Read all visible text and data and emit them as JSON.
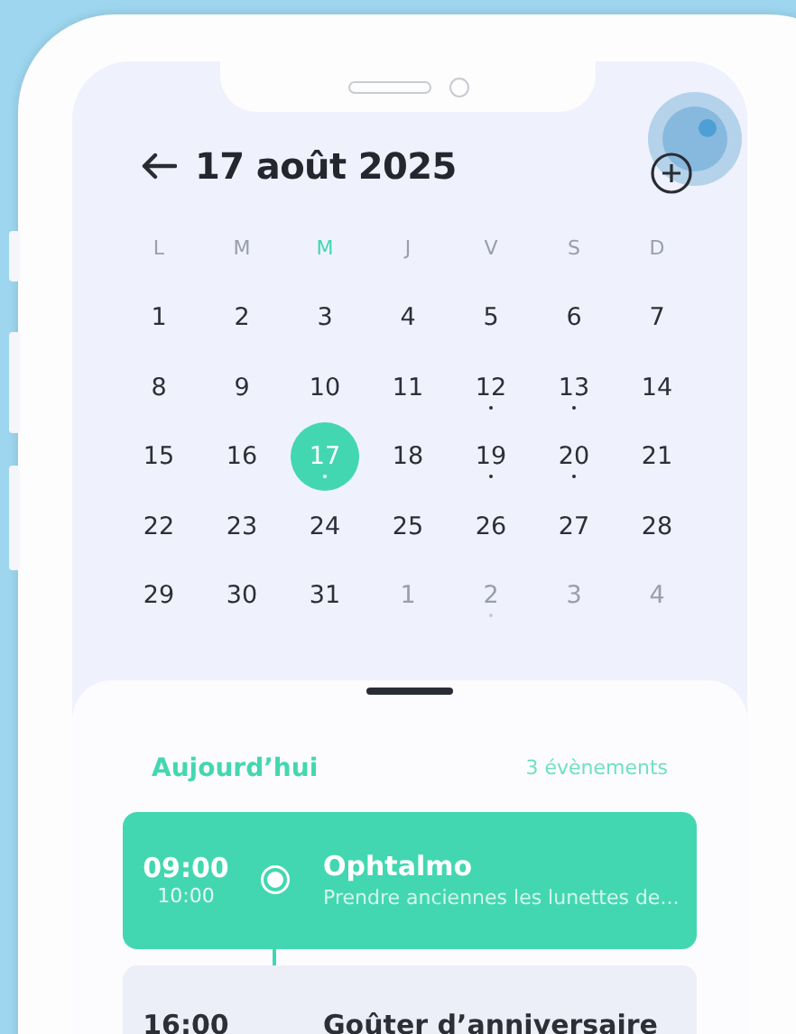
{
  "header": {
    "title": "17 août 2025"
  },
  "weekdays": [
    {
      "label": "L",
      "selected": false
    },
    {
      "label": "M",
      "selected": false
    },
    {
      "label": "M",
      "selected": true
    },
    {
      "label": "J",
      "selected": false
    },
    {
      "label": "V",
      "selected": false
    },
    {
      "label": "S",
      "selected": false
    },
    {
      "label": "D",
      "selected": false
    }
  ],
  "days": [
    {
      "label": "1",
      "muted": false,
      "selected": false,
      "has_event": false
    },
    {
      "label": "2",
      "muted": false,
      "selected": false,
      "has_event": false
    },
    {
      "label": "3",
      "muted": false,
      "selected": false,
      "has_event": false
    },
    {
      "label": "4",
      "muted": false,
      "selected": false,
      "has_event": false
    },
    {
      "label": "5",
      "muted": false,
      "selected": false,
      "has_event": false
    },
    {
      "label": "6",
      "muted": false,
      "selected": false,
      "has_event": false
    },
    {
      "label": "7",
      "muted": false,
      "selected": false,
      "has_event": false
    },
    {
      "label": "8",
      "muted": false,
      "selected": false,
      "has_event": false
    },
    {
      "label": "9",
      "muted": false,
      "selected": false,
      "has_event": false
    },
    {
      "label": "10",
      "muted": false,
      "selected": false,
      "has_event": false
    },
    {
      "label": "11",
      "muted": false,
      "selected": false,
      "has_event": false
    },
    {
      "label": "12",
      "muted": false,
      "selected": false,
      "has_event": true
    },
    {
      "label": "13",
      "muted": false,
      "selected": false,
      "has_event": true
    },
    {
      "label": "14",
      "muted": false,
      "selected": false,
      "has_event": false
    },
    {
      "label": "15",
      "muted": false,
      "selected": false,
      "has_event": false
    },
    {
      "label": "16",
      "muted": false,
      "selected": false,
      "has_event": false
    },
    {
      "label": "17",
      "muted": false,
      "selected": true,
      "has_event": true
    },
    {
      "label": "18",
      "muted": false,
      "selected": false,
      "has_event": false
    },
    {
      "label": "19",
      "muted": false,
      "selected": false,
      "has_event": true
    },
    {
      "label": "20",
      "muted": false,
      "selected": false,
      "has_event": true
    },
    {
      "label": "21",
      "muted": false,
      "selected": false,
      "has_event": false
    },
    {
      "label": "22",
      "muted": false,
      "selected": false,
      "has_event": false
    },
    {
      "label": "23",
      "muted": false,
      "selected": false,
      "has_event": false
    },
    {
      "label": "24",
      "muted": false,
      "selected": false,
      "has_event": false
    },
    {
      "label": "25",
      "muted": false,
      "selected": false,
      "has_event": false
    },
    {
      "label": "26",
      "muted": false,
      "selected": false,
      "has_event": false
    },
    {
      "label": "27",
      "muted": false,
      "selected": false,
      "has_event": false
    },
    {
      "label": "28",
      "muted": false,
      "selected": false,
      "has_event": false
    },
    {
      "label": "29",
      "muted": false,
      "selected": false,
      "has_event": false
    },
    {
      "label": "30",
      "muted": false,
      "selected": false,
      "has_event": false
    },
    {
      "label": "31",
      "muted": false,
      "selected": false,
      "has_event": false
    },
    {
      "label": "1",
      "muted": true,
      "selected": false,
      "has_event": false
    },
    {
      "label": "2",
      "muted": true,
      "selected": false,
      "has_event": true
    },
    {
      "label": "3",
      "muted": true,
      "selected": false,
      "has_event": false
    },
    {
      "label": "4",
      "muted": true,
      "selected": false,
      "has_event": false
    }
  ],
  "agenda": {
    "heading": "Aujourd’hui",
    "count": "3 évènements",
    "events": [
      {
        "start": "09:00",
        "end": "10:00",
        "title": "Ophtalmo",
        "note": "Prendre anciennes les lunettes de...",
        "selected": true
      },
      {
        "start": "16:00",
        "title": "Goûter d’anniversaire",
        "selected": false
      }
    ]
  }
}
